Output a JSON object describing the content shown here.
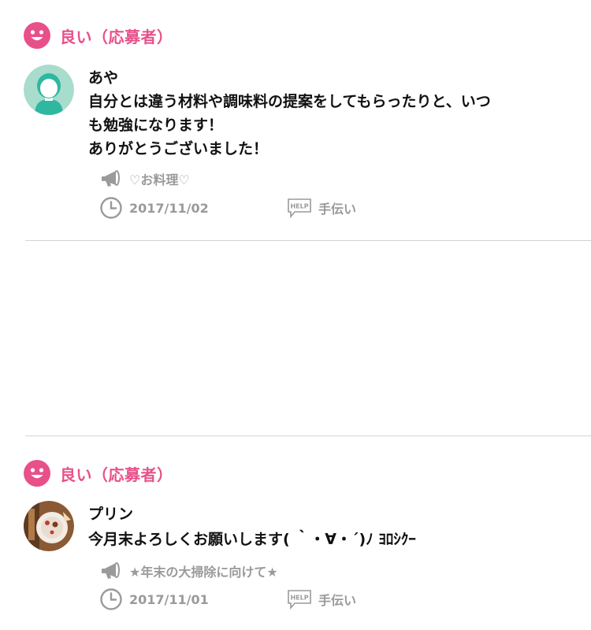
{
  "reviews": [
    {
      "rating_label": "良い（応募者）",
      "user_name": "あや",
      "comment_lines": [
        "自分とは違う材料や調味料の提案をしてもらったりと、いつ",
        "も勉強になります！",
        "ありがとうございました！"
      ],
      "post_title": "♡お料理♡",
      "date": "2017/11/02",
      "category": "手伝い",
      "help_badge": "HELP",
      "avatar_icon": "person-avatar-icon"
    },
    {
      "rating_label": "良い（応募者）",
      "user_name": "プリン",
      "comment_lines": [
        "今月末よろしくお願いします( ｀・∀・´)ﾉ ﾖﾛｼｸｰ"
      ],
      "post_title": "★年末の大掃除に向けて★",
      "date": "2017/11/01",
      "category": "手伝い",
      "help_badge": "HELP",
      "avatar_icon": "photo-avatar-icon"
    }
  ],
  "colors": {
    "accent": "#e8508a",
    "avatar_bg": "#a8dccd",
    "avatar_figure": "#2fb7a0",
    "meta_gray": "#9a9a9a",
    "divider": "#d4d4d4"
  }
}
